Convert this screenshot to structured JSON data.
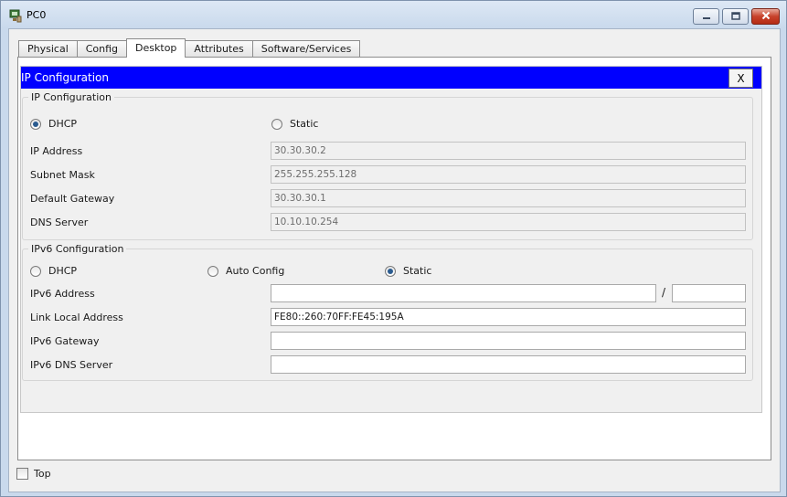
{
  "window": {
    "title": "PC0",
    "icon": "pc-monitor-icon",
    "controls": [
      "minimize-icon",
      "maximize-icon",
      "close-icon"
    ]
  },
  "tabs": [
    "Physical",
    "Config",
    "Desktop",
    "Attributes",
    "Software/Services"
  ],
  "active_tab": "Desktop",
  "app": {
    "title": "IP Configuration",
    "close_label": "X"
  },
  "ipv4": {
    "legend": "IP Configuration",
    "mode_dhcp": "DHCP",
    "mode_static": "Static",
    "selected_mode": "DHCP",
    "ip_label": "IP Address",
    "ip_value": "30.30.30.2",
    "mask_label": "Subnet Mask",
    "mask_value": "255.255.255.128",
    "gateway_label": "Default Gateway",
    "gateway_value": "30.30.30.1",
    "dns_label": "DNS Server",
    "dns_value": "10.10.10.254"
  },
  "ipv6": {
    "legend": "IPv6 Configuration",
    "mode_dhcp": "DHCP",
    "mode_auto": "Auto Config",
    "mode_static": "Static",
    "selected_mode": "Static",
    "address_label": "IPv6 Address",
    "address_value": "",
    "prefix_separator": "/",
    "prefix_value": "",
    "link_local_label": "Link Local Address",
    "link_local_value": "FE80::260:70FF:FE45:195A",
    "gateway_label": "IPv6 Gateway",
    "gateway_value": "",
    "dns_label": "IPv6 DNS Server",
    "dns_value": ""
  },
  "footer": {
    "top_label": "Top",
    "top_checked": false
  }
}
